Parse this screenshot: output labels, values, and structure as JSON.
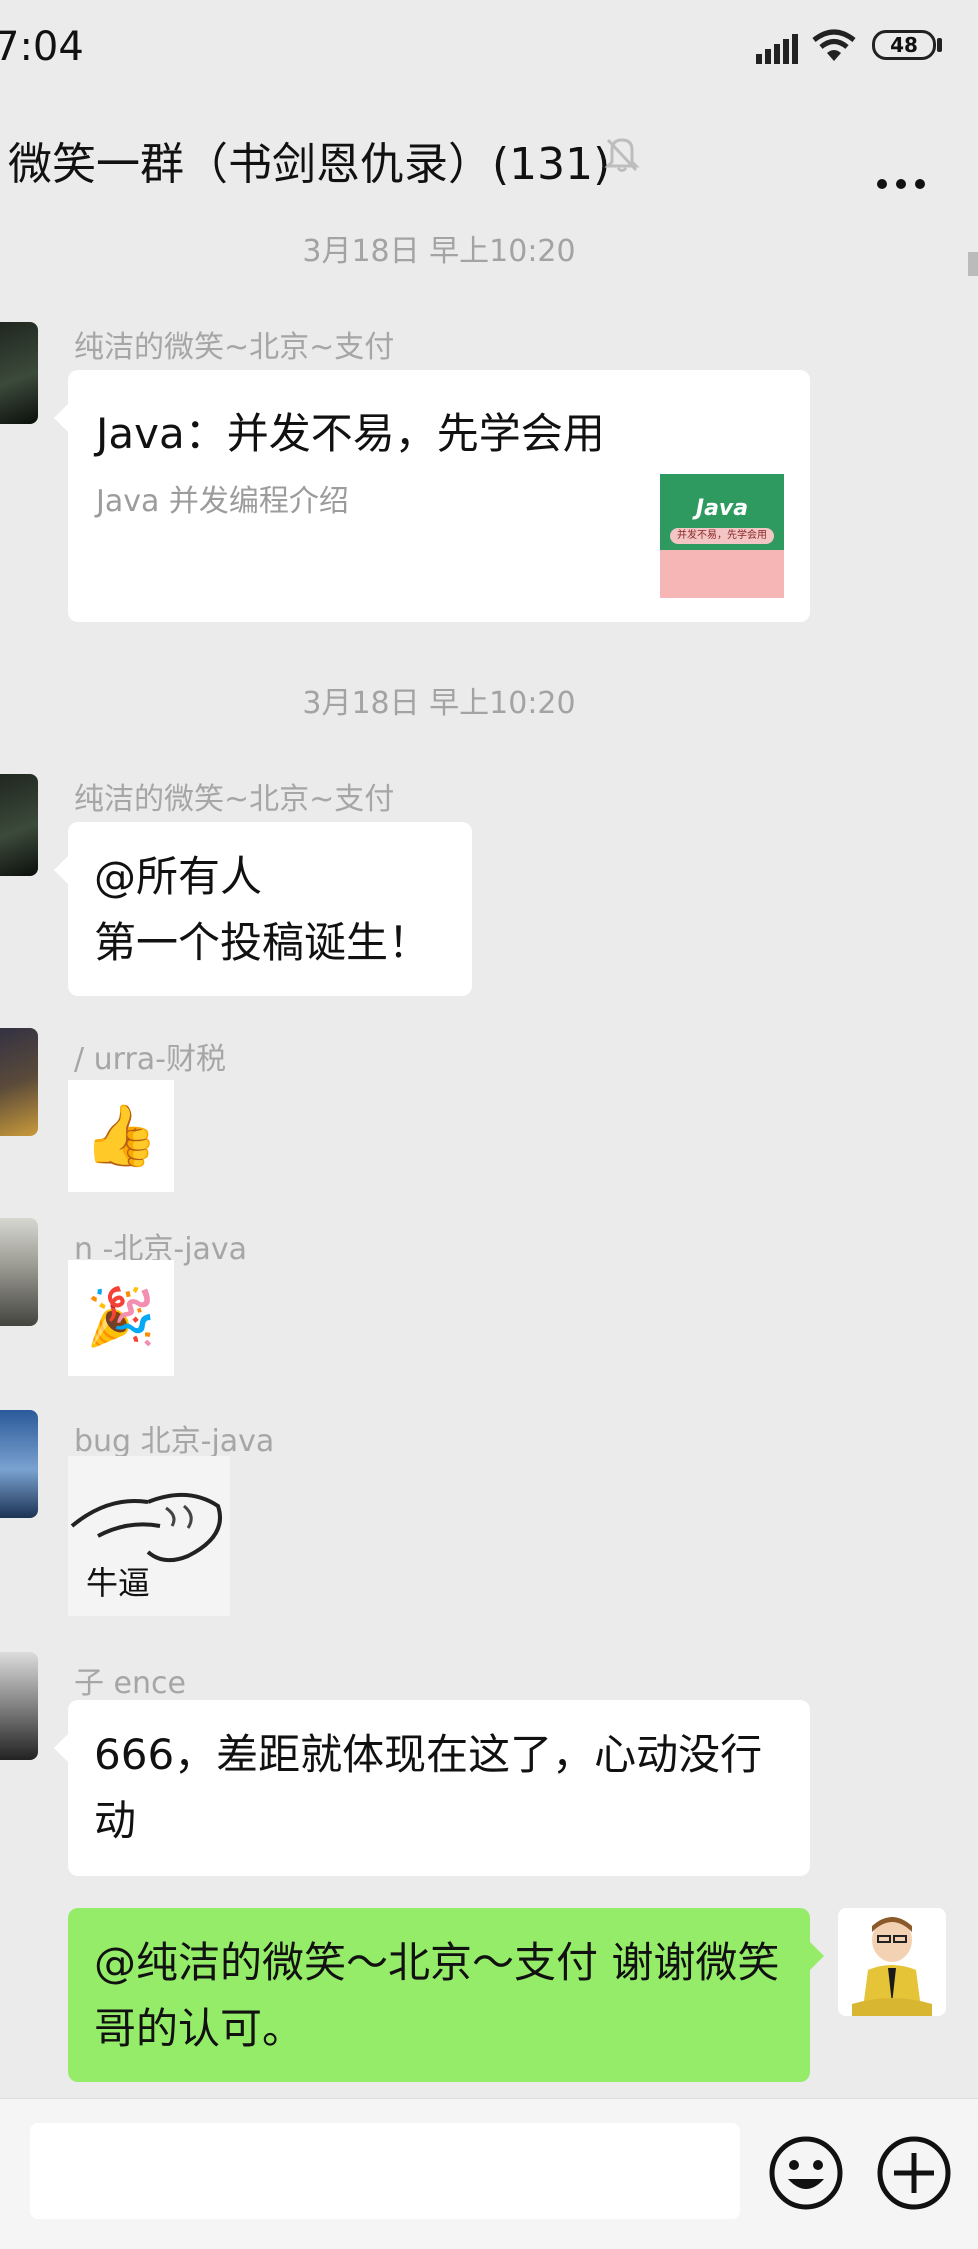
{
  "status_bar": {
    "time": "7:04",
    "battery": "48"
  },
  "header": {
    "title": "微笑一群（书剑恩仇录）(131)"
  },
  "messages": {
    "ts1": "3月18日 早上10:20",
    "m1": {
      "sender": "纯洁的微笑~北京~支付",
      "link_title": "Java：并发不易，先学会用",
      "link_desc": "Java 并发编程介绍",
      "thumb_title": "Java",
      "thumb_caption": "并发不易，先学会用"
    },
    "ts2": "3月18日 早上10:20",
    "m2": {
      "sender": "纯洁的微笑~北京~支付",
      "line1": "@所有人",
      "line2": "第一个投稿诞生！"
    },
    "m3": {
      "sender": "/      urra-财税",
      "emoji": "👍"
    },
    "m4": {
      "sender": "n        -北京-java",
      "emoji": "🎉"
    },
    "m5": {
      "sender": "bug        北京-java",
      "sticker_caption": "牛逼"
    },
    "m6": {
      "sender": "子        ence",
      "text": "666，差距就体现在这了，心动没行动"
    },
    "m7": {
      "text": "@纯洁的微笑～北京～支付 谢谢微笑哥的认可。"
    }
  },
  "colors": {
    "background": "#ebebeb",
    "bubble": "#ffffff",
    "self_bubble": "#95ec69",
    "meta_text": "#a6a6a6"
  },
  "icons": {
    "signal": "signal-icon",
    "wifi": "wifi-icon",
    "battery": "battery-icon",
    "mute": "bell-off-icon",
    "more": "more-icon",
    "emoji": "emoji-icon",
    "plus": "plus-circle-icon"
  }
}
